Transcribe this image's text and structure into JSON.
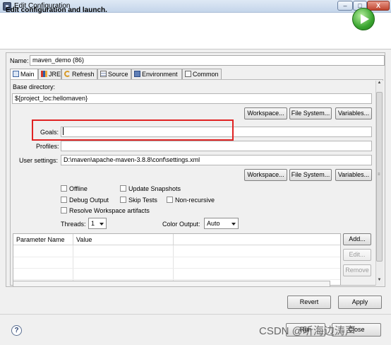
{
  "window": {
    "title": "Edit Configuration",
    "min_label": "–",
    "max_label": "□",
    "close_label": "X"
  },
  "banner": {
    "title": "Edit configuration and launch."
  },
  "config": {
    "name_label": "Name:",
    "name_value": "maven_demo (86)"
  },
  "tabs": [
    {
      "label": "Main",
      "icon": "main-tab-icon"
    },
    {
      "label": "JRE",
      "icon": "jre-icon"
    },
    {
      "label": "Refresh",
      "icon": "refresh-icon"
    },
    {
      "label": "Source",
      "icon": "source-icon"
    },
    {
      "label": "Environment",
      "icon": "environment-icon"
    },
    {
      "label": "Common",
      "icon": "common-icon"
    }
  ],
  "main": {
    "base_dir_label": "Base directory:",
    "base_dir_value": "${project_loc:hellomaven}",
    "workspace_btn": "Workspace...",
    "filesystem_btn": "File System...",
    "variables_btn": "Variables...",
    "goals_label": "Goals:",
    "goals_value": "",
    "profiles_label": "Profiles:",
    "profiles_value": "",
    "user_settings_label": "User settings:",
    "user_settings_value": "D:\\maven\\apache-maven-3.8.8\\conf\\settings.xml",
    "workspace_btn2": "Workspace...",
    "filesystem_btn2": "File System...",
    "variables_btn2": "Variables...",
    "checkboxes": {
      "offline": "Offline",
      "update_snapshots": "Update Snapshots",
      "debug_output": "Debug Output",
      "skip_tests": "Skip Tests",
      "non_recursive": "Non-recursive",
      "resolve_workspace": "Resolve Workspace artifacts"
    },
    "threads_label": "Threads:",
    "threads_value": "1",
    "color_output_label": "Color Output:",
    "color_output_value": "Auto",
    "table": {
      "col_name": "Parameter Name",
      "col_value": "Value"
    },
    "add_btn": "Add...",
    "edit_btn": "Edit...",
    "remove_btn": "Remove"
  },
  "footer": {
    "revert_btn": "Revert",
    "apply_btn": "Apply",
    "run_btn": "Run",
    "close_btn": "Close",
    "watermark": "CSDN @听海边涛声"
  },
  "colors": {
    "highlight_box": "#e02323",
    "run_icon": "#3aa52f"
  }
}
